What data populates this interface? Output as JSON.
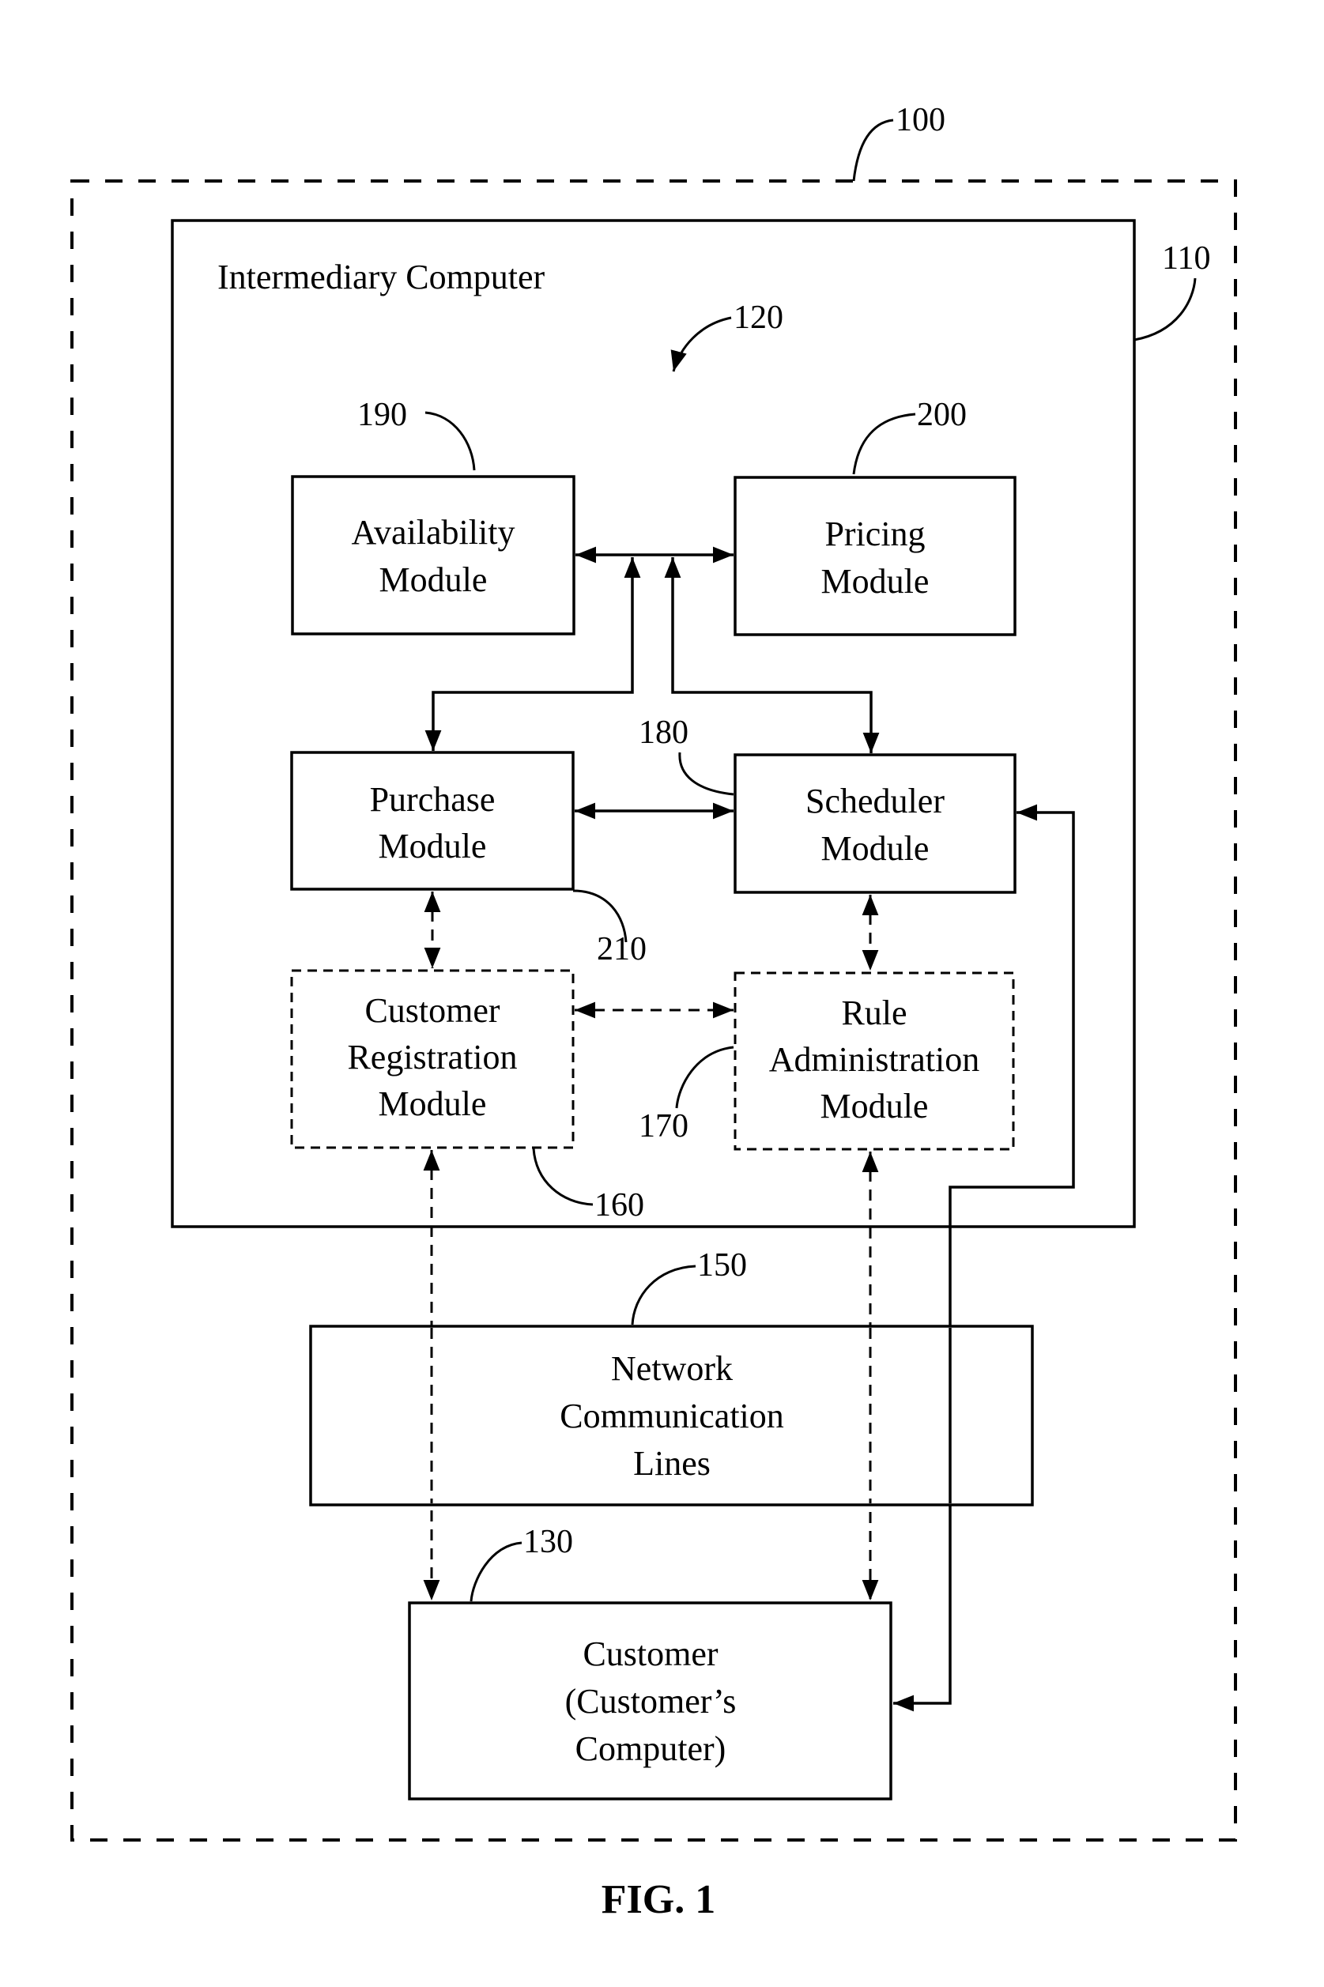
{
  "figure": {
    "caption": "FIG. 1",
    "container_ref": "100",
    "intermediary": {
      "title": "Intermediary Computer",
      "ref": "110",
      "group_ref": "120"
    },
    "modules": {
      "availability": {
        "lines": [
          "Availability",
          "Module"
        ],
        "ref": "190"
      },
      "pricing": {
        "lines": [
          "Pricing",
          "Module"
        ],
        "ref": "200"
      },
      "purchase": {
        "lines": [
          "Purchase",
          "Module"
        ],
        "ref": "210"
      },
      "scheduler": {
        "lines": [
          "Scheduler",
          "Module"
        ],
        "ref": "180"
      },
      "customer_registration": {
        "lines": [
          "Customer",
          "Registration",
          "Module"
        ],
        "ref": "160"
      },
      "rule_administration": {
        "lines": [
          "Rule",
          "Administration",
          "Module"
        ],
        "ref": "170"
      }
    },
    "network": {
      "lines": [
        "Network",
        "Communication",
        "Lines"
      ],
      "ref": "150"
    },
    "customer": {
      "lines": [
        "Customer",
        "(Customer’s",
        "Computer)"
      ],
      "ref": "130"
    }
  }
}
